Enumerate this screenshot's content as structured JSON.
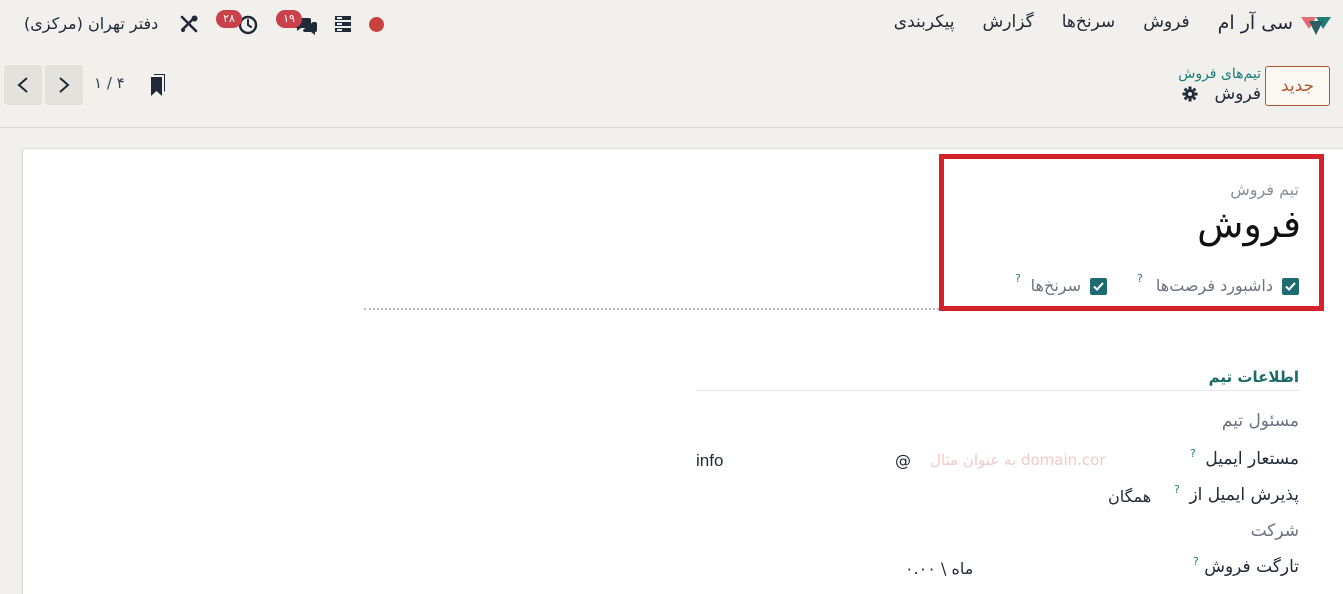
{
  "navbar": {
    "brand": "سی آر ام",
    "menu": [
      "فروش",
      "سرنخ‌ها",
      "گزارش",
      "پیکربندی"
    ],
    "company": "دفتر تهران (مرکزی)",
    "activity_count": "۲۸",
    "messages_count": "۱۹",
    "colors": {
      "badge": "#c9414b",
      "record_dot": "#c8433f"
    }
  },
  "control_panel": {
    "new_button": "جدید",
    "breadcrumb_parent": "تیم‌های فروش",
    "breadcrumb_current": "فروش",
    "pager": "۱ / ۴"
  },
  "form": {
    "label": "تیم فروش",
    "name": "فروش",
    "checkboxes": [
      {
        "label": "داشبورد فرصت‌ها",
        "checked": true
      },
      {
        "label": "سرنخ‌ها",
        "checked": true
      }
    ],
    "help_mark": "?",
    "section_title": "اطلاعات تیم",
    "fields": {
      "team_leader": {
        "label": "مسئول تیم"
      },
      "email_alias": {
        "label": "مستعار ایمیل",
        "value": "info",
        "at": "@",
        "placeholder": "به عنوان مثال domain.cor"
      },
      "accept_from": {
        "label": "پذیرش ایمیل از",
        "value": "همگان"
      },
      "company": {
        "label": "شرکت"
      },
      "target": {
        "label": "تارگت فروش",
        "value": "۰.۰۰ \\ ماه"
      }
    },
    "colors": {
      "accent": "#1a7f7a",
      "highlight": "#d6202a",
      "checkbox": "#1f6b73"
    }
  }
}
